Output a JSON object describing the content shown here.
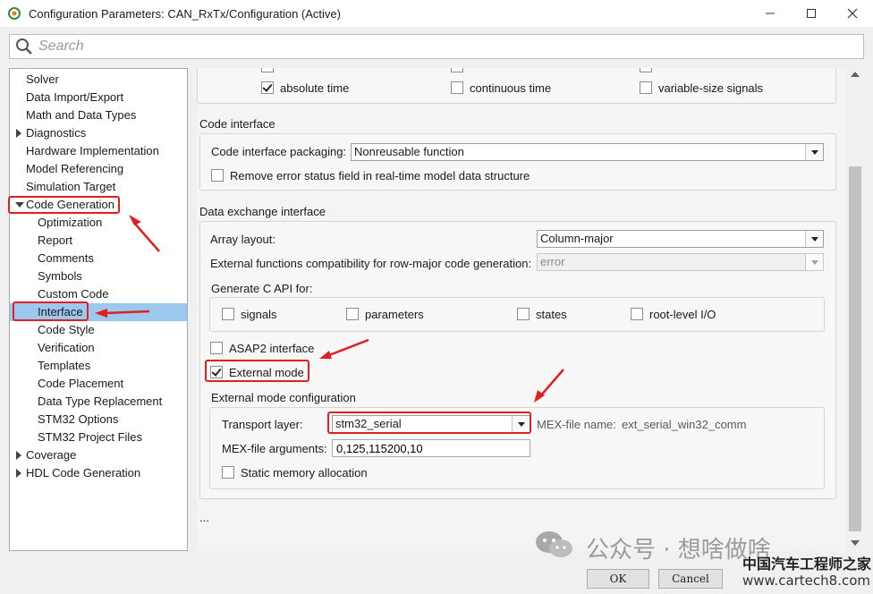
{
  "window": {
    "title": "Configuration Parameters: CAN_RxTx/Configuration (Active)",
    "minimize": "—",
    "maximize": "☐",
    "close": "✕"
  },
  "search": {
    "placeholder": "Search"
  },
  "tree": {
    "items": [
      {
        "label": "Solver"
      },
      {
        "label": "Data Import/Export"
      },
      {
        "label": "Math and Data Types"
      },
      {
        "label": "Diagnostics"
      },
      {
        "label": "Hardware Implementation"
      },
      {
        "label": "Model Referencing"
      },
      {
        "label": "Simulation Target"
      },
      {
        "label": "Code Generation"
      },
      {
        "label": "Optimization"
      },
      {
        "label": "Report"
      },
      {
        "label": "Comments"
      },
      {
        "label": "Symbols"
      },
      {
        "label": "Custom Code"
      },
      {
        "label": "Interface"
      },
      {
        "label": "Code Style"
      },
      {
        "label": "Verification"
      },
      {
        "label": "Templates"
      },
      {
        "label": "Code Placement"
      },
      {
        "label": "Data Type Replacement"
      },
      {
        "label": "STM32 Options"
      },
      {
        "label": "STM32 Project Files"
      },
      {
        "label": "Coverage"
      },
      {
        "label": "HDL Code Generation"
      }
    ],
    "selected": "Interface"
  },
  "top_group": {
    "absolute_time": {
      "label": "absolute time",
      "checked": true
    },
    "continuous_time": {
      "label": "continuous time",
      "checked": false
    },
    "variable_size": {
      "label": "variable-size signals",
      "checked": false
    }
  },
  "code_interface": {
    "title": "Code interface",
    "packaging_label": "Code interface packaging:",
    "packaging_value": "Nonreusable function",
    "remove_error_label": "Remove error status field in real-time model data structure",
    "remove_error_checked": false
  },
  "data_exchange": {
    "title": "Data exchange interface",
    "array_layout_label": "Array layout:",
    "array_layout_value": "Column-major",
    "ext_compat_label": "External functions compatibility for row-major code generation:",
    "ext_compat_value": "error",
    "c_api_label": "Generate C API for:",
    "c_api": {
      "signals": "signals",
      "parameters": "parameters",
      "states": "states",
      "root_io": "root-level I/O"
    },
    "asap2_label": "ASAP2 interface",
    "asap2_checked": false,
    "external_mode_label": "External mode",
    "external_mode_checked": true
  },
  "external_mode_config": {
    "title": "External mode configuration",
    "transport_label": "Transport layer:",
    "transport_value": "stm32_serial",
    "mex_name_label": "MEX-file name:",
    "mex_name_value": "ext_serial_win32_comm",
    "mex_args_label": "MEX-file arguments:",
    "mex_args_value": "0,125,115200,10",
    "static_mem_label": "Static memory allocation",
    "static_mem_checked": false
  },
  "ellipsis": "...",
  "buttons": {
    "ok": "OK",
    "cancel": "Cancel"
  },
  "watermark": {
    "line1": "公众号 · 想啥做啥",
    "line2": "中国汽车工程师之家",
    "line3": "www.cartech8.com"
  },
  "colors": {
    "selected_bg": "#9cc8ee",
    "highlight_red": "#e02020"
  }
}
